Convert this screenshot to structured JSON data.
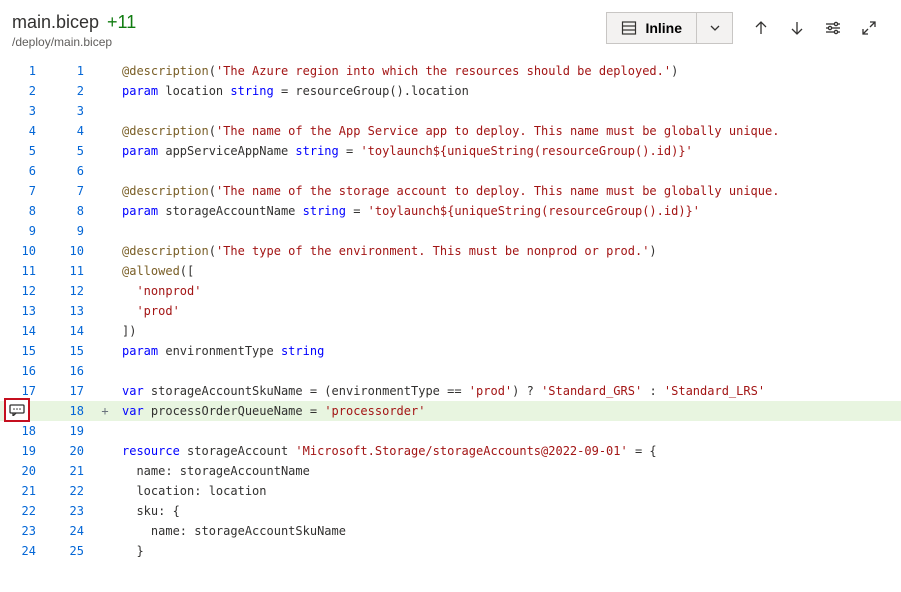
{
  "header": {
    "fileName": "main.bicep",
    "changeCount": "+11",
    "filePath": "/deploy/main.bicep"
  },
  "toolbar": {
    "viewMode": "Inline"
  },
  "lines": [
    {
      "l": "1",
      "r": "1",
      "m": "",
      "tokens": [
        [
          "dec",
          "@description"
        ],
        [
          "",
          ")"
        ],
        [
          "",
          "("
        ],
        [
          "str",
          "'The Azure region into which the resources should be deployed.'"
        ],
        [
          "",
          ")"
        ]
      ],
      "raw": "@description('The Azure region into which the resources should be deployed.')"
    },
    {
      "l": "2",
      "r": "2",
      "m": "",
      "raw": "param location string = resourceGroup().location"
    },
    {
      "l": "3",
      "r": "3",
      "m": "",
      "raw": ""
    },
    {
      "l": "4",
      "r": "4",
      "m": "",
      "raw": "@description('The name of the App Service app to deploy. This name must be globally unique."
    },
    {
      "l": "5",
      "r": "5",
      "m": "",
      "raw": "param appServiceAppName string = 'toylaunch${uniqueString(resourceGroup().id)}'"
    },
    {
      "l": "6",
      "r": "6",
      "m": "",
      "raw": ""
    },
    {
      "l": "7",
      "r": "7",
      "m": "",
      "raw": "@description('The name of the storage account to deploy. This name must be globally unique."
    },
    {
      "l": "8",
      "r": "8",
      "m": "",
      "raw": "param storageAccountName string = 'toylaunch${uniqueString(resourceGroup().id)}'"
    },
    {
      "l": "9",
      "r": "9",
      "m": "",
      "raw": ""
    },
    {
      "l": "10",
      "r": "10",
      "m": "",
      "raw": "@description('The type of the environment. This must be nonprod or prod.')"
    },
    {
      "l": "11",
      "r": "11",
      "m": "",
      "raw": "@allowed(["
    },
    {
      "l": "12",
      "r": "12",
      "m": "",
      "raw": "  'nonprod'"
    },
    {
      "l": "13",
      "r": "13",
      "m": "",
      "raw": "  'prod'"
    },
    {
      "l": "14",
      "r": "14",
      "m": "",
      "raw": "])"
    },
    {
      "l": "15",
      "r": "15",
      "m": "",
      "raw": "param environmentType string"
    },
    {
      "l": "16",
      "r": "16",
      "m": "",
      "raw": ""
    },
    {
      "l": "17",
      "r": "17",
      "m": "",
      "raw": "var storageAccountSkuName = (environmentType == 'prod') ? 'Standard_GRS' : 'Standard_LRS'"
    },
    {
      "l": "",
      "r": "18",
      "m": "+",
      "added": true,
      "comment": true,
      "raw": "var processOrderQueueName = 'processorder'"
    },
    {
      "l": "18",
      "r": "19",
      "m": "",
      "raw": ""
    },
    {
      "l": "19",
      "r": "20",
      "m": "",
      "raw": "resource storageAccount 'Microsoft.Storage/storageAccounts@2022-09-01' = {"
    },
    {
      "l": "20",
      "r": "21",
      "m": "",
      "raw": "  name: storageAccountName"
    },
    {
      "l": "21",
      "r": "22",
      "m": "",
      "raw": "  location: location"
    },
    {
      "l": "22",
      "r": "23",
      "m": "",
      "raw": "  sku: {"
    },
    {
      "l": "23",
      "r": "24",
      "m": "",
      "raw": "    name: storageAccountSkuName"
    },
    {
      "l": "24",
      "r": "25",
      "m": "",
      "raw": "  }"
    }
  ]
}
